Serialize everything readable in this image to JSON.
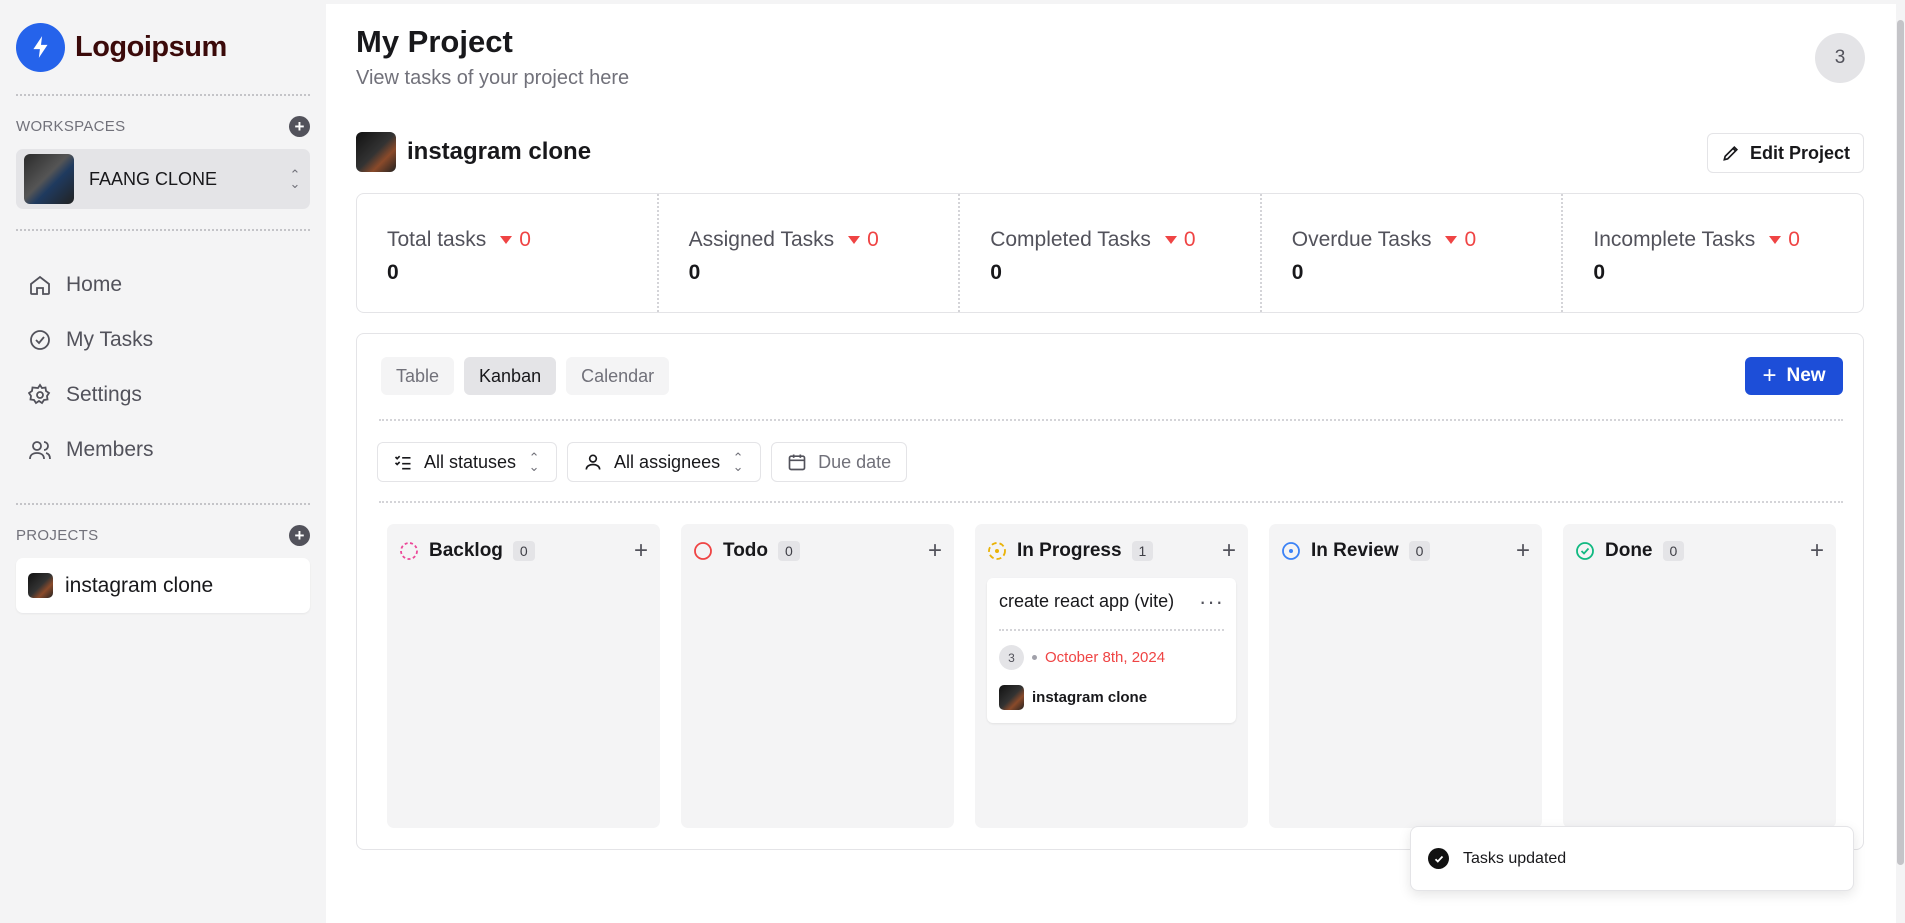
{
  "brand": {
    "name": "Logoipsum",
    "color": "#2563eb"
  },
  "sidebar": {
    "workspaces_label": "WORKSPACES",
    "workspace_name": "FAANG CLONE",
    "nav": [
      {
        "label": "Home",
        "icon": "home-icon"
      },
      {
        "label": "My Tasks",
        "icon": "check-circle-icon"
      },
      {
        "label": "Settings",
        "icon": "gear-icon"
      },
      {
        "label": "Members",
        "icon": "users-icon"
      }
    ],
    "projects_label": "PROJECTS",
    "projects": [
      {
        "label": "instagram clone"
      }
    ]
  },
  "header": {
    "title": "My Project",
    "subtitle": "View tasks of your project here",
    "avatar_initial": "3"
  },
  "project": {
    "name": "instagram clone",
    "edit_label": "Edit Project"
  },
  "stats": [
    {
      "label": "Total tasks",
      "delta": "0",
      "value": "0"
    },
    {
      "label": "Assigned Tasks",
      "delta": "0",
      "value": "0"
    },
    {
      "label": "Completed Tasks",
      "delta": "0",
      "value": "0"
    },
    {
      "label": "Overdue Tasks",
      "delta": "0",
      "value": "0"
    },
    {
      "label": "Incomplete Tasks",
      "delta": "0",
      "value": "0"
    }
  ],
  "views": {
    "tabs": [
      "Table",
      "Kanban",
      "Calendar"
    ],
    "active": "Kanban",
    "new_label": "New"
  },
  "filters": {
    "status": "All statuses",
    "assignee": "All assignees",
    "due": "Due date"
  },
  "columns": [
    {
      "title": "Backlog",
      "count": "0",
      "color": "#ec4899"
    },
    {
      "title": "Todo",
      "count": "0",
      "color": "#ef4444"
    },
    {
      "title": "In Progress",
      "count": "1",
      "color": "#eab308"
    },
    {
      "title": "In Review",
      "count": "0",
      "color": "#3b82f6"
    },
    {
      "title": "Done",
      "count": "0",
      "color": "#10b981"
    }
  ],
  "task": {
    "title": "create react app (vite)",
    "assignee_initial": "3",
    "due": "October 8th, 2024",
    "project": "instagram clone"
  },
  "toast": {
    "message": "Tasks updated"
  }
}
